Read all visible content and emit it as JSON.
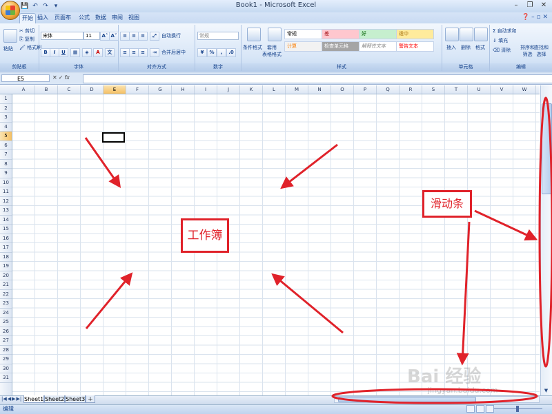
{
  "window": {
    "title": "Book1 - Microsoft Excel",
    "minimize": "–",
    "restore": "❐",
    "close": "✕"
  },
  "qat": {
    "save": "💾",
    "undo": "↶",
    "redo": "↷",
    "customize": "▾"
  },
  "tabs": [
    "开始",
    "插入",
    "页面布局",
    "公式",
    "数据",
    "审阅",
    "视图"
  ],
  "ribbon": {
    "clipboard": {
      "paste": "粘贴",
      "cut": "剪切",
      "copy": "复制",
      "format_painter": "格式刷",
      "label": "剪贴板"
    },
    "font": {
      "name": "宋体",
      "size": "11",
      "bold": "B",
      "italic": "I",
      "underline": "U",
      "grow": "A˄",
      "shrink": "A˅",
      "font_color": "A",
      "label": "字体"
    },
    "alignment": {
      "wrap": "自动换行",
      "merge": "合并后居中",
      "label": "对齐方式"
    },
    "number": {
      "format": "常规",
      "label": "数字"
    },
    "styles": {
      "conditional": "条件格式",
      "table_format": "套用\n表格格式",
      "cells": [
        "常规",
        "差",
        "好",
        "适中",
        "计算",
        "检查单元格",
        "解释性文本",
        "警告文本"
      ],
      "label": "样式"
    },
    "cells": {
      "insert": "插入",
      "delete": "删除",
      "format": "格式",
      "label": "单元格"
    },
    "editing": {
      "autosum": "自动求和",
      "fill": "填充",
      "clear": "清除",
      "sort": "排序和\n筛选",
      "find": "查找和\n选择",
      "label": "编辑"
    }
  },
  "formula_bar": {
    "name_box": "E5",
    "fx": "fx",
    "cancel": "✕",
    "enter": "✓",
    "value": ""
  },
  "columns": [
    "A",
    "B",
    "C",
    "D",
    "E",
    "F",
    "G",
    "H",
    "I",
    "J",
    "K",
    "L",
    "M",
    "N",
    "O",
    "P",
    "Q",
    "R",
    "S",
    "T",
    "U",
    "V",
    "W"
  ],
  "active_column": "E",
  "rows": [
    "1",
    "2",
    "3",
    "4",
    "5",
    "6",
    "7",
    "8",
    "9",
    "10",
    "11",
    "12",
    "13",
    "14",
    "15",
    "16",
    "17",
    "18",
    "19",
    "20",
    "21",
    "22",
    "23",
    "24",
    "25",
    "26",
    "27",
    "28",
    "29",
    "30",
    "31"
  ],
  "active_row": "5",
  "sheets": [
    "Sheet1",
    "Sheet2",
    "Sheet3"
  ],
  "active_sheet": "Sheet1",
  "status": {
    "mode": "编辑"
  },
  "annotations": {
    "workbook_label": "工作簿",
    "scrollbar_label": "滑动条",
    "color": "#e0222a"
  },
  "watermark": {
    "main": "Bai 经验",
    "sub": "jingyan.baidu.com"
  },
  "colors": {
    "ribbon_bg": "#d8e6f7",
    "accent": "#15428b",
    "grid_line": "#dae3ee",
    "active_header": "#f5c064"
  }
}
